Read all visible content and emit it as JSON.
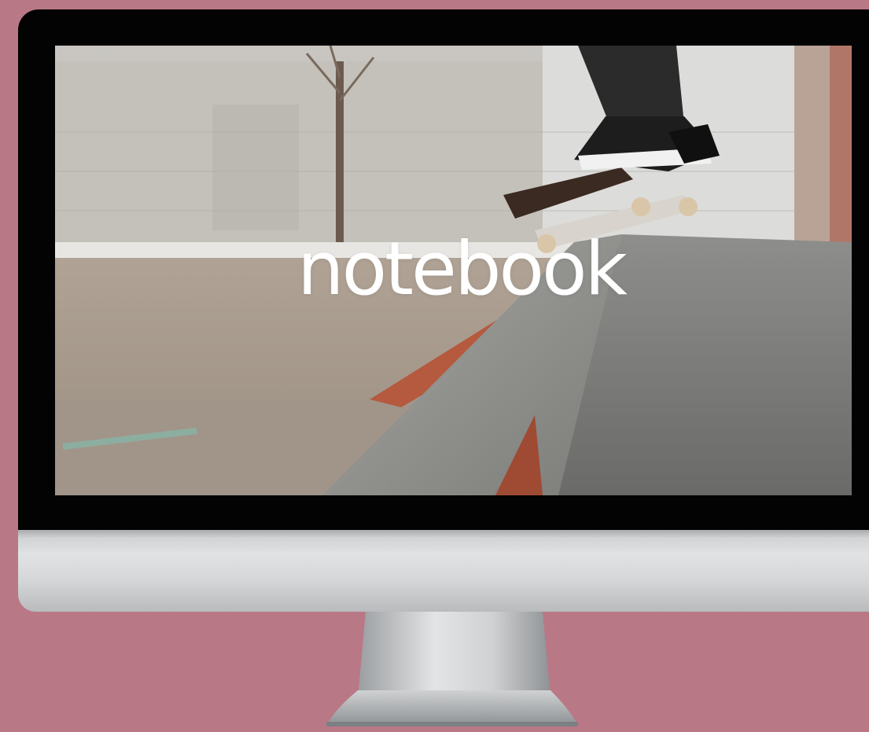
{
  "screen": {
    "logo_text": "notebook"
  },
  "colors": {
    "background": "#b97886",
    "bezel": "#030303",
    "chin": "#d6d7d8",
    "logo": "#ffffff"
  }
}
